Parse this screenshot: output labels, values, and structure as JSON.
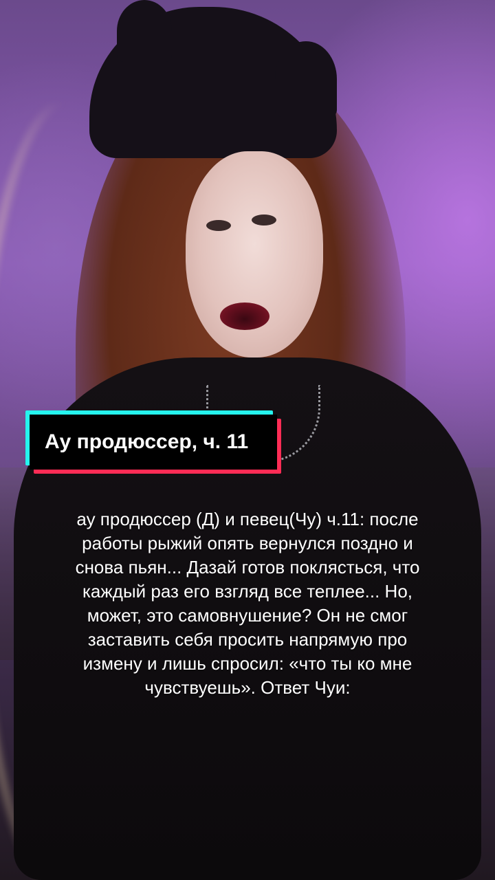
{
  "video": {
    "title_card": {
      "text": "Ау продюссер, ч. 11",
      "colors": {
        "cyan": "#25f4ee",
        "pink": "#fe2c55",
        "background": "#000000",
        "text": "#ffffff"
      }
    },
    "caption_lines": [
      "ау продюссер (Д) и певец(Чу) ч.11: после",
      "работы рыжий опять вернулся поздно и",
      "снова пьян... Дазай готов поклясться, что",
      "каждый раз его взгляд все теплее... Но,",
      "может, это самовнушение? Он не смог",
      "заставить себя просить напрямую про",
      "измену и лишь спросил: «что ты ко мне",
      "чувствуешь». Ответ Чуи:"
    ]
  }
}
